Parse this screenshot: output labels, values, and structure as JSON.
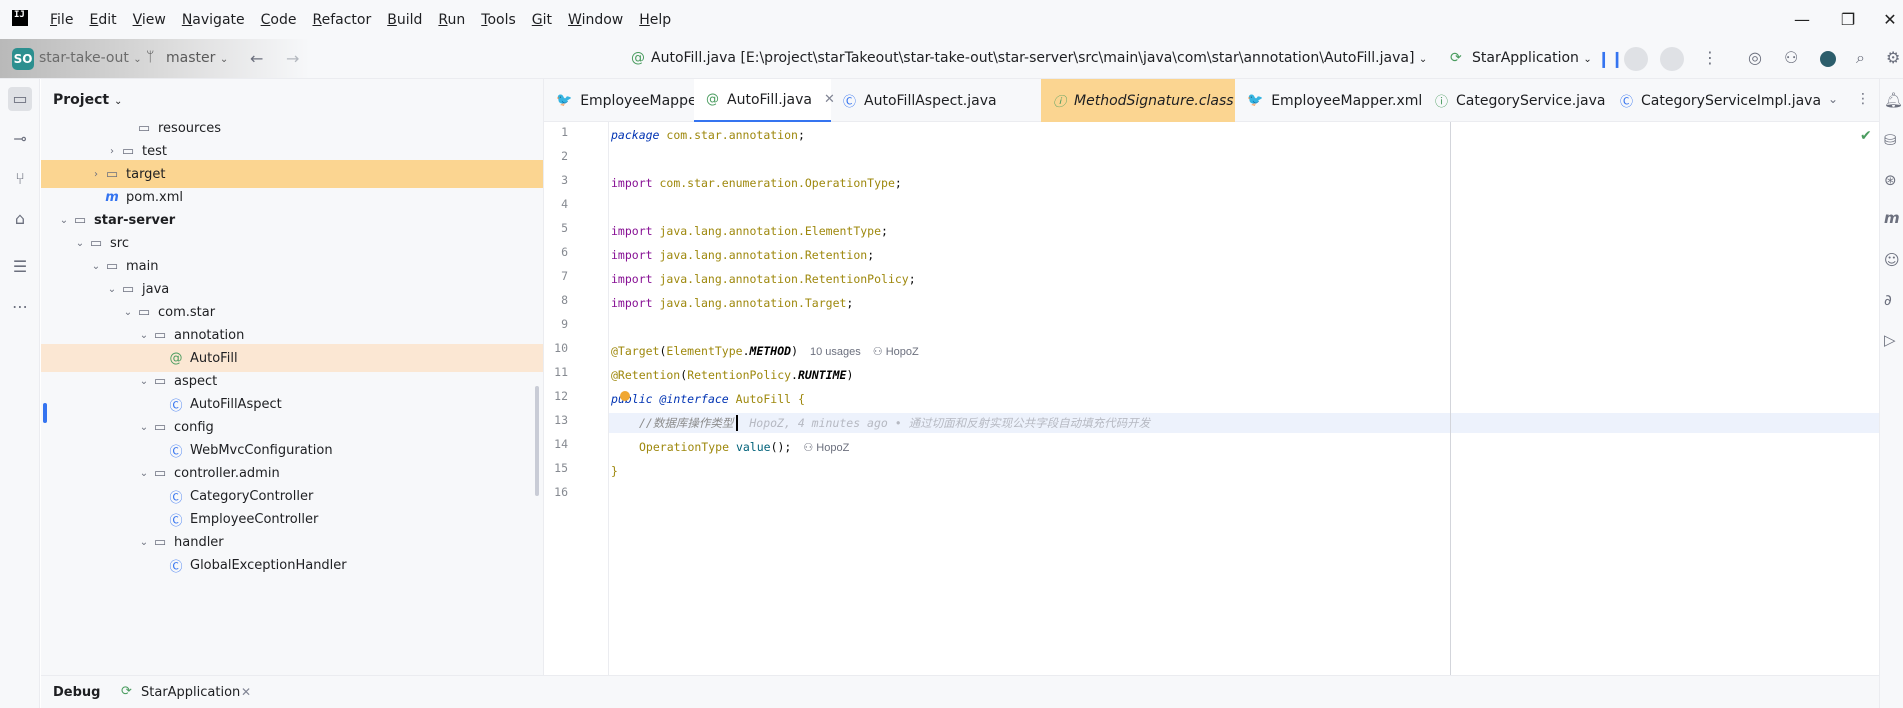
{
  "menubar": {
    "logo": "IJ",
    "items": [
      {
        "label": "File",
        "mnemonic": "F",
        "rest": "ile"
      },
      {
        "label": "Edit",
        "mnemonic": "E",
        "rest": "dit"
      },
      {
        "label": "View",
        "mnemonic": "V",
        "rest": "iew"
      },
      {
        "label": "Navigate",
        "mnemonic": "N",
        "rest": "avigate"
      },
      {
        "label": "Code",
        "mnemonic": "C",
        "rest": "ode"
      },
      {
        "label": "Refactor",
        "mnemonic": "R",
        "rest": "efactor"
      },
      {
        "label": "Build",
        "mnemonic": "B",
        "rest": "uild"
      },
      {
        "label": "Run",
        "mnemonic": "R",
        "rest": "un"
      },
      {
        "label": "Tools",
        "mnemonic": "T",
        "rest": "ools"
      },
      {
        "label": "Git",
        "mnemonic": "G",
        "rest": "it"
      },
      {
        "label": "Window",
        "mnemonic": "W",
        "rest": "indow"
      },
      {
        "label": "Help",
        "mnemonic": "H",
        "rest": "elp"
      }
    ],
    "window_controls": {
      "minimize": "—",
      "restore": "❐",
      "close": "✕"
    }
  },
  "toolbar": {
    "project_badge": "SO",
    "project_name": "star-take-out",
    "branch": "master",
    "file_title": "AutoFill.java [E:\\project\\starTakeout\\star-take-out\\star-server\\src\\main\\java\\com\\star\\annotation\\AutoFill.java]",
    "run_config": "StarApplication"
  },
  "project_panel": {
    "title": "Project",
    "tree": [
      {
        "label": "resources",
        "depth": 5,
        "chevron": "",
        "icon": "folder"
      },
      {
        "label": "test",
        "depth": 4,
        "chevron": "right",
        "icon": "folder"
      },
      {
        "label": "target",
        "depth": 3,
        "chevron": "right",
        "icon": "folder",
        "state": "highlight"
      },
      {
        "label": "pom.xml",
        "depth": 3,
        "chevron": "",
        "icon": "maven"
      },
      {
        "label": "star-server",
        "depth": 1,
        "chevron": "down",
        "icon": "module",
        "bold": true
      },
      {
        "label": "src",
        "depth": 2,
        "chevron": "down",
        "icon": "folder"
      },
      {
        "label": "main",
        "depth": 3,
        "chevron": "down",
        "icon": "folder"
      },
      {
        "label": "java",
        "depth": 4,
        "chevron": "down",
        "icon": "folder"
      },
      {
        "label": "com.star",
        "depth": 5,
        "chevron": "down",
        "icon": "package"
      },
      {
        "label": "annotation",
        "depth": 6,
        "chevron": "down",
        "icon": "package"
      },
      {
        "label": "AutoFill",
        "depth": 7,
        "chevron": "",
        "icon": "annotation",
        "state": "selected"
      },
      {
        "label": "aspect",
        "depth": 6,
        "chevron": "down",
        "icon": "package"
      },
      {
        "label": "AutoFillAspect",
        "depth": 7,
        "chevron": "",
        "icon": "class"
      },
      {
        "label": "config",
        "depth": 6,
        "chevron": "down",
        "icon": "package"
      },
      {
        "label": "WebMvcConfiguration",
        "depth": 7,
        "chevron": "",
        "icon": "class"
      },
      {
        "label": "controller.admin",
        "depth": 6,
        "chevron": "down",
        "icon": "package"
      },
      {
        "label": "CategoryController",
        "depth": 7,
        "chevron": "",
        "icon": "class"
      },
      {
        "label": "EmployeeController",
        "depth": 7,
        "chevron": "",
        "icon": "class"
      },
      {
        "label": "handler",
        "depth": 6,
        "chevron": "down",
        "icon": "package"
      },
      {
        "label": "GlobalExceptionHandler",
        "depth": 7,
        "chevron": "",
        "icon": "class"
      }
    ]
  },
  "tabs": [
    {
      "label": "EmployeeMapper.java",
      "icon": "mapper",
      "state": ""
    },
    {
      "label": "AutoFill.java",
      "icon": "annotation",
      "state": "active",
      "close": "✕"
    },
    {
      "label": "AutoFillAspect.java",
      "icon": "class",
      "state": ""
    },
    {
      "label": "MethodSignature.class",
      "icon": "interface",
      "state": "highlight"
    },
    {
      "label": "EmployeeMapper.xml",
      "icon": "mapper",
      "state": ""
    },
    {
      "label": "CategoryService.java",
      "icon": "interface",
      "state": ""
    },
    {
      "label": "CategoryServiceImpl.java",
      "icon": "class",
      "state": ""
    }
  ],
  "editor": {
    "line_numbers": [
      "1",
      "2",
      "3",
      "4",
      "5",
      "6",
      "7",
      "8",
      "9",
      "10",
      "11",
      "12",
      "13",
      "14",
      "15",
      "16"
    ],
    "code": {
      "l1_kw": "package",
      "l1_pkg": " com.star.annotation",
      "l1_end": ";",
      "import_kw": "import",
      "l3_pkg": " com.star.enumeration.",
      "l3_cls": "OperationType",
      "l5_pkg": " java.lang.annotation.",
      "l5_cls": "ElementType",
      "l6_cls": "Retention",
      "l7_cls": "RetentionPolicy",
      "l8_cls": "Target",
      "semicolon": ";",
      "l10_ann": "@Target",
      "l10_arg_type": "ElementType",
      "l10_arg_const": "METHOD",
      "l10_usages": "10 usages",
      "author": "HopoZ",
      "l11_ann": "@Retention",
      "l11_arg_type": "RetentionPolicy",
      "l11_arg_const": "RUNTIME",
      "l12_public": "public",
      "l12_interface": "@interface",
      "l12_name": " AutoFill",
      "l12_brace": " {",
      "l13_comment": "//数据库操作类型",
      "l13_blame": "HopoZ, 4 minutes ago • 通过切面和反射实现公共字段自动填充代码开发",
      "l14_type": "OperationType",
      "l14_method": " value",
      "l14_rest": "();",
      "l15_brace": "}"
    }
  },
  "bottom_bar": {
    "tab_label": "Debug",
    "run_config": "StarApplication",
    "close": "✕"
  },
  "colors": {
    "accent": "#3574f0",
    "highlight": "#fbd591",
    "selection": "#fbe7d3",
    "current_line": "#edf2fc"
  }
}
